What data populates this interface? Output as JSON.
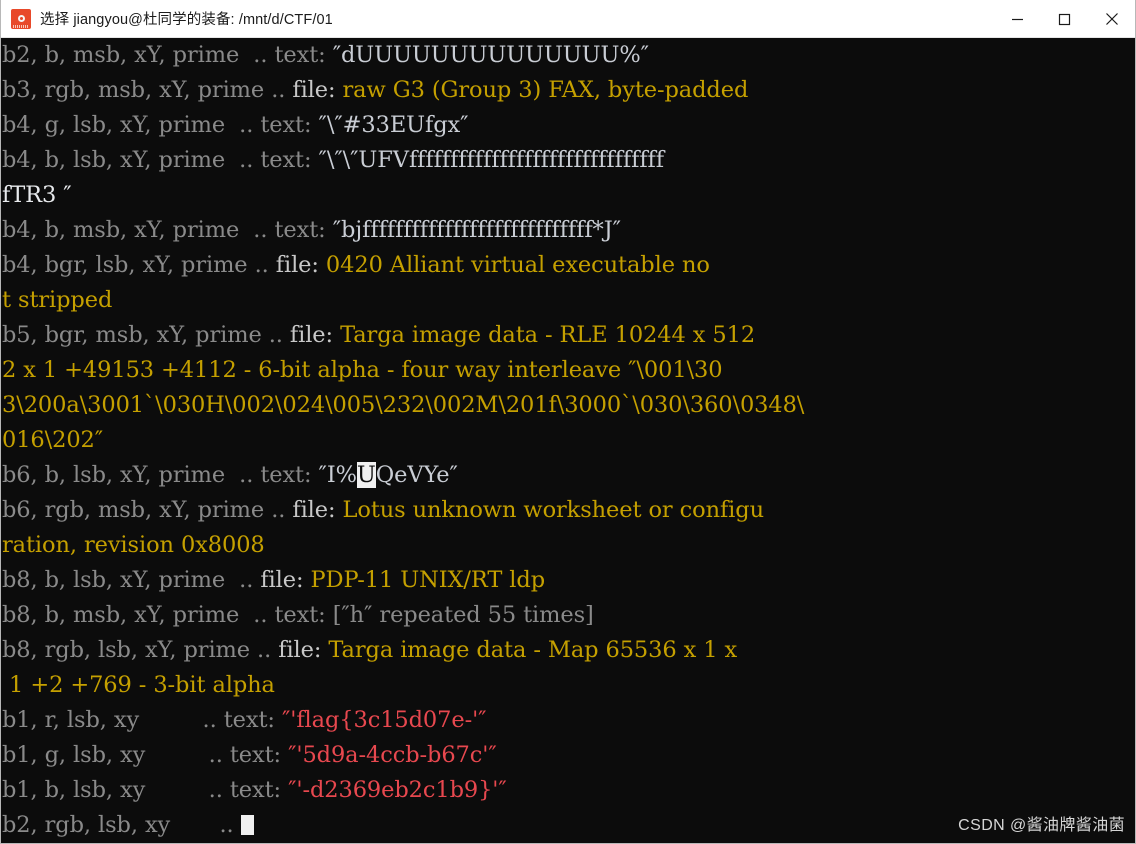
{
  "window": {
    "title": "选择 jiangyou@杜同学的装备: /mnt/d/CTF/01",
    "icon": "terminal-icon",
    "controls": {
      "minimize": "minimize-icon",
      "maximize": "maximize-icon",
      "close": "close-icon"
    }
  },
  "terminal": {
    "background_color": "#0c0c0c",
    "dim_color": "#8a8a8a",
    "label_color": "#c8c8c8",
    "text_value_color": "#c9cdd4",
    "file_value_color": "#c5a000",
    "flag_color": "#e8484f",
    "cursor_color": "#f0f0f0",
    "rows": [
      {
        "id": "r1",
        "spec": "b2, b, msb, xY, prime ",
        "sep": " .. ",
        "label": "text:",
        "label_style": "dim",
        "value": "″dUUUUUUUUUUUUUU%″",
        "value_style": "text"
      },
      {
        "id": "r2",
        "spec": "b3, rgb, msb, xY, prime",
        "sep": " .. ",
        "label": "file:",
        "label_style": "label",
        "value": "raw G3 (Group 3) FAX, byte-padded ",
        "value_style": "file"
      },
      {
        "id": "r3",
        "spec": "b4, g, lsb, xY, prime ",
        "sep": " .. ",
        "label": "text:",
        "label_style": "dim",
        "value": "″\\″#33EUfgx″",
        "value_style": "text"
      },
      {
        "id": "r4",
        "spec": "b4, b, lsb, xY, prime ",
        "sep": " .. ",
        "label": "text:",
        "label_style": "dim",
        "value": "″\\″\\″UFVfffffffffffffffffffffffffffffff",
        "value_style": "text"
      },
      {
        "id": "r5",
        "cont": true,
        "value": "fTR3 ″",
        "value_style": "white"
      },
      {
        "id": "r6",
        "spec": "b4, b, msb, xY, prime ",
        "sep": " .. ",
        "label": "text:",
        "label_style": "dim",
        "value": "″bjffffffffffffffffffffffffffff*J″",
        "value_style": "text"
      },
      {
        "id": "r7",
        "spec": "b4, bgr, lsb, xY, prime",
        "sep": " .. ",
        "label": "file:",
        "label_style": "label",
        "value": "0420 Alliant virtual executable no",
        "value_style": "file"
      },
      {
        "id": "r8",
        "cont": true,
        "value": "t stripped",
        "value_style": "file"
      },
      {
        "id": "r9",
        "spec": "b5, bgr, msb, xY, prime",
        "sep": " .. ",
        "label": "file:",
        "label_style": "label",
        "value": "Targa image data - RLE 10244 x 512",
        "value_style": "file"
      },
      {
        "id": "r10",
        "cont": true,
        "value": "2 x 1 +49153 +4112 - 6-bit alpha - four way interleave ″\\001\\30",
        "value_style": "file"
      },
      {
        "id": "r11",
        "cont": true,
        "value": "3\\200a\\3001`\\030H\\002\\024\\005\\232\\002M\\201f\\3000`\\030\\360\\0348\\",
        "value_style": "file"
      },
      {
        "id": "r12",
        "cont": true,
        "value": "016\\202″",
        "value_style": "file"
      },
      {
        "id": "r13",
        "spec": "b6, b, lsb, xY, prime ",
        "sep": " .. ",
        "label": "text:",
        "label_style": "dim",
        "value": "″I%UQeVYe″",
        "value_style": "text",
        "cursor_index": 3
      },
      {
        "id": "r14",
        "spec": "b6, rgb, msb, xY, prime",
        "sep": " .. ",
        "label": "file:",
        "label_style": "label",
        "value": "Lotus unknown worksheet or configu",
        "value_style": "file"
      },
      {
        "id": "r15",
        "cont": true,
        "value": "ration, revision 0x8008",
        "value_style": "file"
      },
      {
        "id": "r16",
        "spec": "b8, b, lsb, xY, prime ",
        "sep": " .. ",
        "label": "file:",
        "label_style": "label",
        "value": "PDP-11 UNIX/RT ldp",
        "value_style": "file"
      },
      {
        "id": "r17",
        "spec": "b8, b, msb, xY, prime ",
        "sep": " .. ",
        "label": "text:",
        "label_style": "dim",
        "value": "[″h″ repeated 55 times]",
        "value_style": "dim"
      },
      {
        "id": "r18",
        "spec": "b8, rgb, lsb, xY, prime",
        "sep": " .. ",
        "label": "file:",
        "label_style": "label",
        "value": "Targa image data - Map 65536 x 1 x",
        "value_style": "file"
      },
      {
        "id": "r19",
        "cont": true,
        "value": " 1 +2 +769 - 3-bit alpha",
        "value_style": "file"
      },
      {
        "id": "r20",
        "spec": "b1, r, lsb, xy        ",
        "sep": " .. ",
        "label": "text:",
        "label_style": "dim",
        "value": "″'flag{3c15d07e-'″",
        "value_style": "flag"
      },
      {
        "id": "r21",
        "spec": "b1, g, lsb, xy        ",
        "sep": " .. ",
        "label": "text:",
        "label_style": "dim",
        "value": "″'5d9a-4ccb-b67c'″",
        "value_style": "flag"
      },
      {
        "id": "r22",
        "spec": "b1, b, lsb, xy        ",
        "sep": " .. ",
        "label": "text:",
        "label_style": "dim",
        "value": "″'-d2369eb2c1b9}'″",
        "value_style": "flag"
      },
      {
        "id": "r23",
        "spec": "b2, rgb, lsb, xy      ",
        "sep": " .. ",
        "label": "",
        "label_style": "dim",
        "value": "",
        "value_style": "dim",
        "trailing_cursor": true
      }
    ],
    "recovered_flag": "flag{3c15d07e-5d9a-4ccb-b67c-d2369eb2c1b9}"
  },
  "watermark": {
    "text": "CSDN @酱油牌酱油菌"
  }
}
